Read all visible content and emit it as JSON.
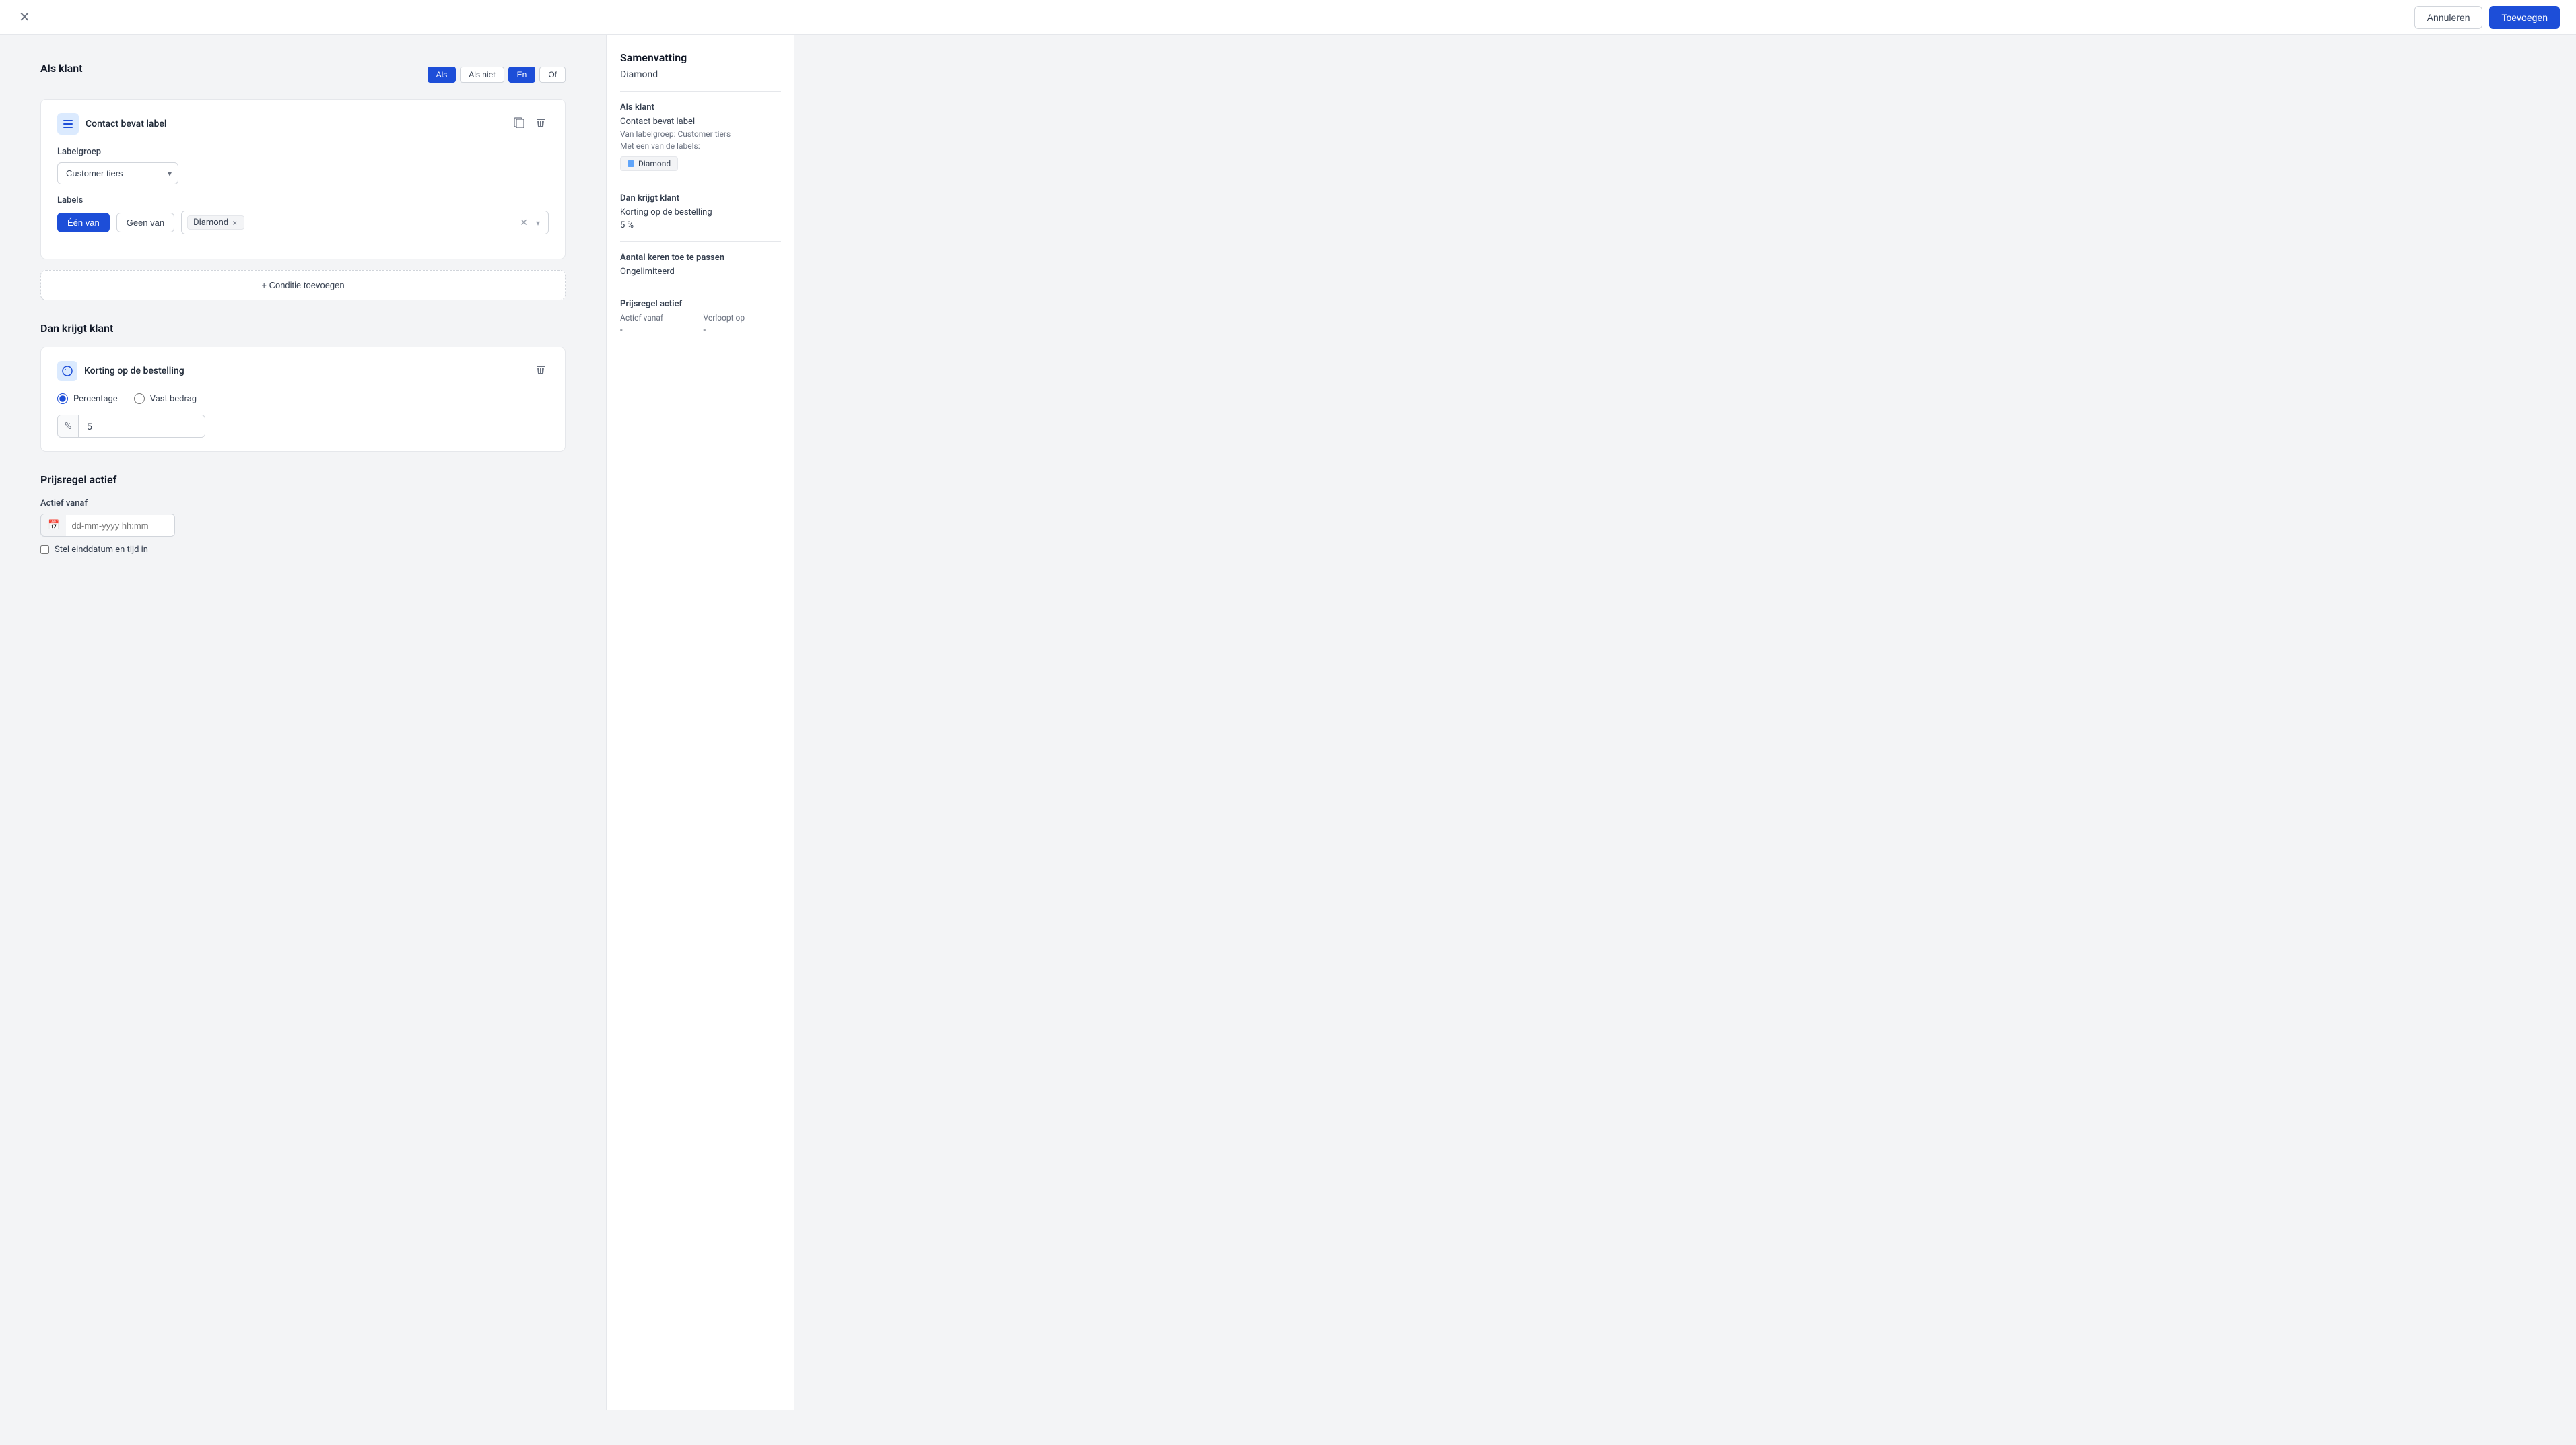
{
  "topbar": {
    "cancel_label": "Annuleren",
    "save_label": "Toevoegen"
  },
  "als_klant": {
    "title": "Als klant",
    "toggle_als": "Als",
    "toggle_als_niet": "Als niet",
    "toggle_en": "En",
    "toggle_of": "Of"
  },
  "condition_block": {
    "title": "Contact bevat label",
    "labelgroep_label": "Labelgroep",
    "labelgroep_value": "Customer tiers",
    "labels_label": "Labels",
    "toggle_een_van": "Één van",
    "toggle_geen_van": "Geen van",
    "tag_diamond": "Diamond"
  },
  "add_condition": {
    "label": "+ Conditie toevoegen"
  },
  "dan_krijgt": {
    "title": "Dan krijgt klant"
  },
  "discount_block": {
    "title": "Korting op de bestelling",
    "radio_percentage": "Percentage",
    "radio_vast": "Vast bedrag",
    "input_value": "5",
    "input_prefix": "✕"
  },
  "prijsregel": {
    "title": "Prijsregel actief",
    "actief_vanaf_label": "Actief vanaf",
    "actief_vanaf_placeholder": "dd-mm-yyyy hh:mm",
    "einddatum_label": "Stel einddatum en tijd in"
  },
  "summary": {
    "title": "Samenvatting",
    "subtitle": "Diamond",
    "als_klant_label": "Als klant",
    "contact_bevat_label": "Contact bevat label",
    "van_labelgroep": "Van labelgroep:",
    "labelgroep_value": "Customer tiers",
    "met_een_van": "Met een van de labels:",
    "badge_diamond": "Diamond",
    "dan_krijgt_label": "Dan krijgt klant",
    "korting_label": "Korting op de bestelling",
    "korting_value": "5 %",
    "aantal_keren_label": "Aantal keren toe te passen",
    "aantal_keren_value": "Ongelimiteerd",
    "prijsregel_label": "Prijsregel actief",
    "actief_vanaf_col": "Actief vanaf",
    "verloopt_op_col": "Verloopt op",
    "actief_vanaf_val": "-",
    "verloopt_op_val": "-"
  }
}
